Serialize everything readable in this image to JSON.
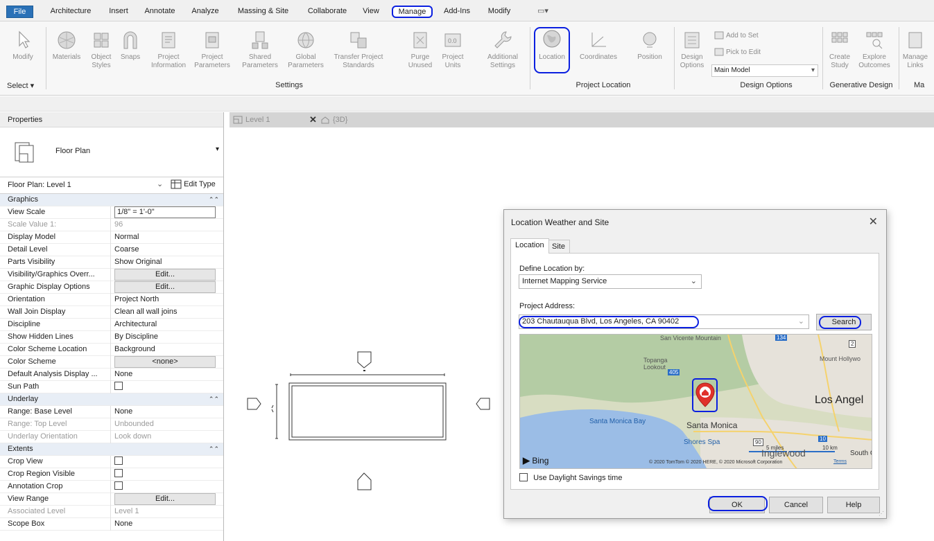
{
  "ribbon": {
    "tabs": [
      "File",
      "Architecture",
      "Insert",
      "Annotate",
      "Analyze",
      "Massing & Site",
      "Collaborate",
      "View",
      "Manage",
      "Add-Ins",
      "Modify",
      "▭▾"
    ],
    "active_tab": "Manage",
    "buttons": {
      "modify": "Modify",
      "materials": "Materials",
      "object_styles": "Object Styles",
      "snaps": "Snaps",
      "project_information": "Project Information",
      "project_parameters": "Project Parameters",
      "shared_parameters": "Shared Parameters",
      "global_parameters": "Global Parameters",
      "transfer_project_standards": "Transfer Project Standards",
      "purge_unused": "Purge Unused",
      "project_units": "Project Units",
      "additional_settings": "Additional Settings",
      "location": "Location",
      "coordinates": "Coordinates",
      "position": "Position",
      "design_options": "Design Options",
      "add_to_set": "Add to Set",
      "pick_to_edit": "Pick to Edit",
      "main_model": "Main Model",
      "create_study": "Create Study",
      "explore_outcomes": "Explore Outcomes",
      "manage_links": "Manage Links"
    },
    "groups": {
      "select": "Select ▾",
      "settings": "Settings",
      "project_location": "Project Location",
      "design_options": "Design Options",
      "generative_design": "Generative Design",
      "manage_cut": "Ma"
    }
  },
  "properties": {
    "title": "Properties",
    "type_name": "Floor Plan",
    "instance_label": "Floor Plan: Level 1",
    "edit_type": "Edit Type",
    "rows": [
      {
        "kind": "cat",
        "name": "Graphics"
      },
      {
        "kind": "box",
        "name": "View Scale",
        "value": "1/8\" = 1'-0\""
      },
      {
        "kind": "dim",
        "name": "Scale Value    1:",
        "value": "96"
      },
      {
        "kind": "text",
        "name": "Display Model",
        "value": "Normal"
      },
      {
        "kind": "text",
        "name": "Detail Level",
        "value": "Coarse"
      },
      {
        "kind": "text",
        "name": "Parts Visibility",
        "value": "Show Original"
      },
      {
        "kind": "btn",
        "name": "Visibility/Graphics Overr...",
        "value": "Edit..."
      },
      {
        "kind": "btn",
        "name": "Graphic Display Options",
        "value": "Edit..."
      },
      {
        "kind": "text",
        "name": "Orientation",
        "value": "Project North"
      },
      {
        "kind": "text",
        "name": "Wall Join Display",
        "value": "Clean all wall joins"
      },
      {
        "kind": "text",
        "name": "Discipline",
        "value": "Architectural"
      },
      {
        "kind": "text",
        "name": "Show Hidden Lines",
        "value": "By Discipline"
      },
      {
        "kind": "text",
        "name": "Color Scheme Location",
        "value": "Background"
      },
      {
        "kind": "btn",
        "name": "Color Scheme",
        "value": "<none>"
      },
      {
        "kind": "text",
        "name": "Default Analysis Display ...",
        "value": "None"
      },
      {
        "kind": "check",
        "name": "Sun Path",
        "value": ""
      },
      {
        "kind": "cat",
        "name": "Underlay"
      },
      {
        "kind": "text",
        "name": "Range: Base Level",
        "value": "None"
      },
      {
        "kind": "dim",
        "name": "Range: Top Level",
        "value": "Unbounded"
      },
      {
        "kind": "dim",
        "name": "Underlay Orientation",
        "value": "Look down"
      },
      {
        "kind": "cat",
        "name": "Extents"
      },
      {
        "kind": "check",
        "name": "Crop View",
        "value": ""
      },
      {
        "kind": "check",
        "name": "Crop Region Visible",
        "value": ""
      },
      {
        "kind": "check",
        "name": "Annotation Crop",
        "value": ""
      },
      {
        "kind": "btn",
        "name": "View Range",
        "value": "Edit..."
      },
      {
        "kind": "dim",
        "name": "Associated Level",
        "value": "Level 1"
      },
      {
        "kind": "text",
        "name": "Scope Box",
        "value": "None"
      }
    ]
  },
  "view_tabs": [
    {
      "label": "Level 1"
    },
    {
      "label": "{3D}"
    }
  ],
  "dialog": {
    "title": "Location Weather and Site",
    "tabs": [
      "Location",
      "Site"
    ],
    "define_label": "Define Location by:",
    "define_value": "Internet Mapping Service",
    "address_label": "Project Address:",
    "address_value": "203 Chautauqua Blvd, Los Angeles, CA 90402",
    "search_label": "Search",
    "daylight_label": "Use Daylight Savings time",
    "ok": "OK",
    "cancel": "Cancel",
    "help": "Help",
    "map": {
      "places": [
        "San Vicente Mountain",
        "Topanga Lookout",
        "Los Angel",
        "Mount Hollywo",
        "Santa Monica Bay",
        "Santa Monica",
        "Shores Spa",
        "Inglewood",
        "South G"
      ],
      "highways": [
        "405",
        "134",
        "2",
        "10",
        "90"
      ],
      "brand": "Bing",
      "copyright": "© 2020 TomTom © 2020 HERE, © 2020 Microsoft Corporation",
      "terms": "Terms",
      "scale_miles": "5 miles",
      "scale_km": "10 km",
      "colors": {
        "water": "#9bbde6",
        "land": "#d8ddc2",
        "green": "#a8c59a",
        "urban": "#e6e2da",
        "pin": "#e0322b"
      }
    }
  },
  "colors": {
    "accent": "#0a1fe0",
    "file_tab": "#2a71b7",
    "category_row": "#e8eef6"
  }
}
